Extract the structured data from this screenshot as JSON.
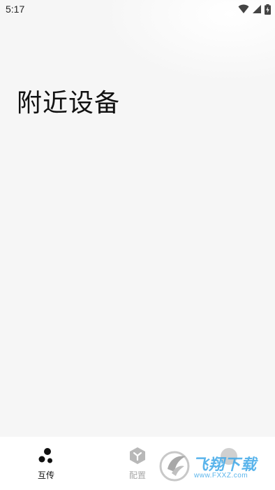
{
  "status_bar": {
    "time": "5:17",
    "icons": [
      "wifi-icon",
      "cell-signal-icon",
      "battery-charging-icon"
    ]
  },
  "main": {
    "title": "附近设备"
  },
  "bottom_nav": {
    "items": [
      {
        "label": "互传",
        "icon": "transfer-dots-icon",
        "active": true
      },
      {
        "label": "配置",
        "icon": "config-box-icon",
        "active": false
      },
      {
        "label": "",
        "icon": "more-circle-icon",
        "active": false
      }
    ]
  },
  "watermark": {
    "brand": "飞翔下载",
    "url": "www.FXXZ.com"
  },
  "colors": {
    "background": "#f6f6f6",
    "nav_background": "#ffffff",
    "active_label": "#111111",
    "inactive_label": "#a8a8a8",
    "watermark": "#3ea8e8"
  }
}
